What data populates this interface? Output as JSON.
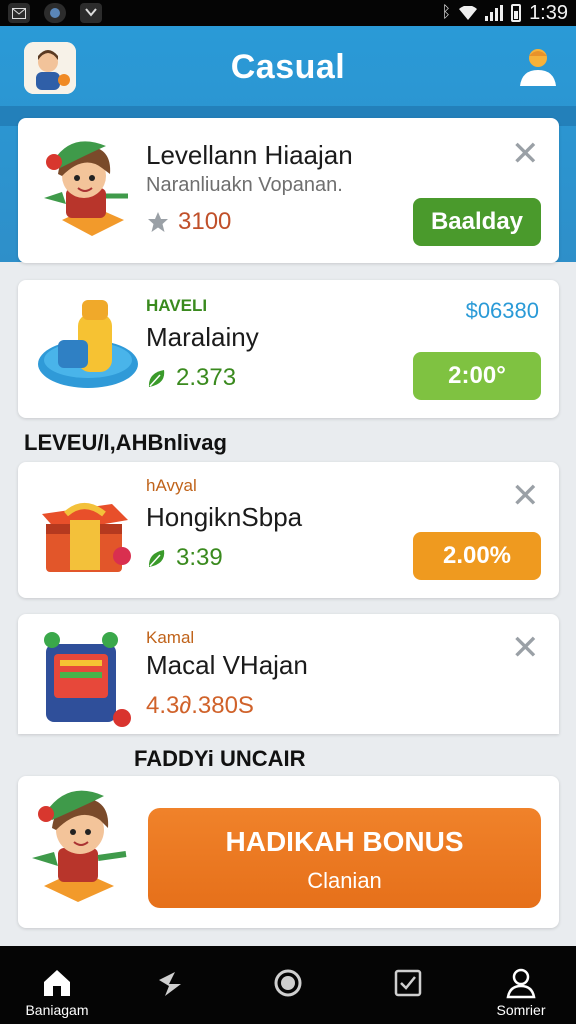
{
  "status_bar": {
    "time": "1:39",
    "left_icons": [
      "mail-icon",
      "app-icon",
      "missed-call-icon"
    ],
    "right_icons": [
      "bluetooth-icon",
      "wifi-icon",
      "signal-icon",
      "battery-icon"
    ]
  },
  "app_bar": {
    "title": "Casual",
    "left_icon": "avatar-icon",
    "right_icon": "profile-icon",
    "color": "#2a9ad7"
  },
  "cards": [
    {
      "title": "Levellann Hiaajan",
      "subtitle": "Naranliuakn Vopanan.",
      "value": "3100",
      "value_icon": "star-icon",
      "button": "Baalday",
      "button_color": "#4a9a2c",
      "close": "✕"
    },
    {
      "tag": "HAVELI",
      "title": "Maralainy",
      "value": "2.373",
      "value_icon": "leaf-icon",
      "price": "$06380",
      "button": "2:00°",
      "button_color": "#7fc241"
    },
    {
      "tag": "hAvyal",
      "title": "HongiknSbpa",
      "value": "3:39",
      "value_icon": "leaf-icon",
      "button": "2.00%",
      "button_color": "#ef9a1f",
      "close": "✕"
    },
    {
      "tag": "Kamal",
      "title": "Macal VHajan",
      "value": "4.3∂.380S",
      "close": "✕"
    }
  ],
  "sections": {
    "level_label": "LEVEU/I,AHBnlivag",
    "daily_label": "FADDYi UNCAIR"
  },
  "bonus": {
    "title": "HADIKAH BONUS",
    "subtitle": "Clanian",
    "color": "#ee7b22"
  },
  "bottom_nav": [
    {
      "label": "Baniagam",
      "icon": "home-icon"
    },
    {
      "label": "",
      "icon": "flash-icon"
    },
    {
      "label": "",
      "icon": "circle-icon"
    },
    {
      "label": "",
      "icon": "checkbox-icon"
    },
    {
      "label": "Somrier",
      "icon": "user-icon"
    }
  ]
}
